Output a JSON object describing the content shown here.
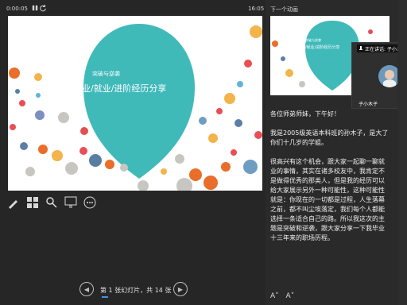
{
  "topbar": {
    "elapsed_time": "0:00:05",
    "clock": "16:05"
  },
  "slide": {
    "title_small": "突破与逆袭",
    "title_main": "择业/就业/进阶经历分享"
  },
  "toolbar": {
    "items": [
      "pen-tool-icon",
      "see-all-slides-icon",
      "zoom-icon",
      "pointer-icon",
      "more-icon"
    ]
  },
  "navigation": {
    "counter_text": "第 1 张幻灯片，共 14 张",
    "prev_label": "◀",
    "next_label": "▶"
  },
  "next_slide": {
    "label": "下一个动画",
    "title_small": "突破与逆袭",
    "title_main": "择业/就业/进阶经历分享"
  },
  "video": {
    "header": "正在讲话: 子小木子",
    "name": "子小木子"
  },
  "notes": {
    "text": "各位师弟师妹，下午好！\n\n我是2005级英语本科班的孙木子，是大了你们十几岁的学姐。\n\n    很高兴有这个机会，跟大家一起聊一聊就业的事情，其实在诸多校友中，我肯定不是做得优秀的那类人，但是我的经历可以给大家展示另外一种可能性，这种可能性就是：你现在的一切都是过程，人生落幕之前，都不叫尘埃落定，我们每个人都能选择一条适合自己的路。所以我这次的主题是突破和逆袭，跟大家分享一下我毕业十三年来的职场历程。"
  },
  "font_controls": {
    "increase": "A˄",
    "decrease": "A˅"
  },
  "colors": {
    "balloon": "#40b9b9",
    "accent_blue": "#4a90e2"
  }
}
